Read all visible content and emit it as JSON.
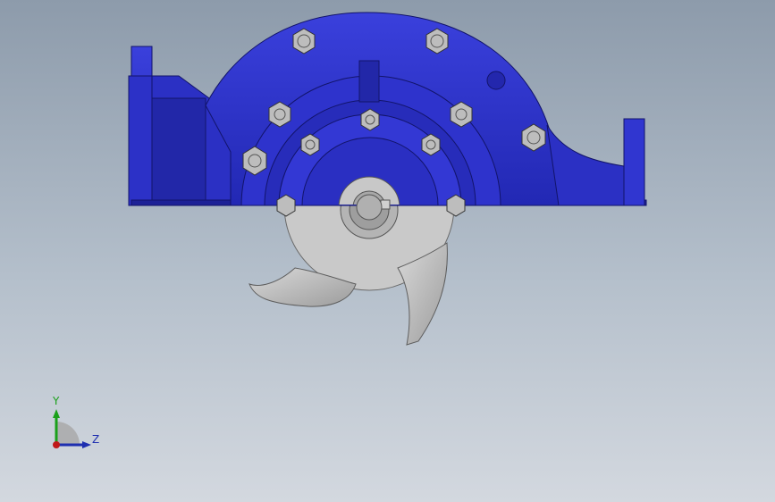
{
  "viewport": {
    "background_top": "#8d9bab",
    "background_bottom": "#d3d8df"
  },
  "model": {
    "housing_color": "#2a2fc8",
    "housing_dark": "#1a1c8f",
    "impeller_color": "#c4c4c4",
    "bolt_color": "#b9b9b9"
  },
  "triad": {
    "y_label": "Y",
    "z_label": "Z",
    "y_color": "#1aa01a",
    "z_color": "#1f2fb0",
    "x_color": "#c01818"
  }
}
